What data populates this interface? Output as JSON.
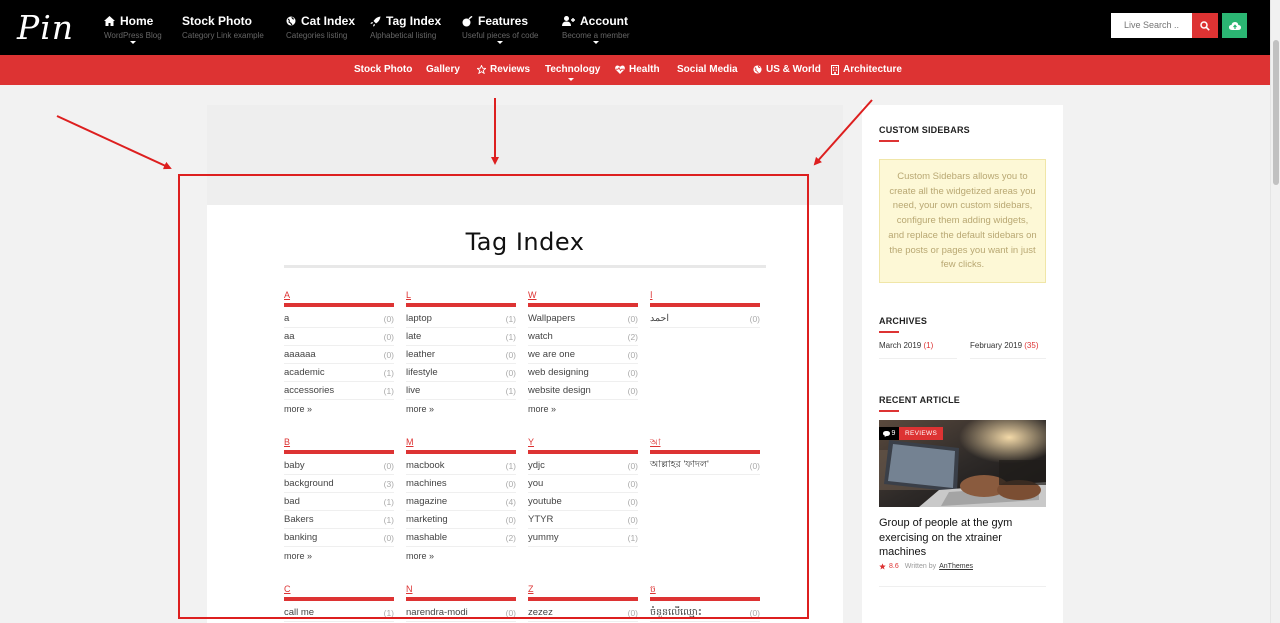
{
  "header": {
    "logo": "Pin",
    "nav": [
      {
        "label": "Home",
        "sub": "WordPress Blog",
        "icon": "home-icon",
        "has_caret": true
      },
      {
        "label": "Stock Photo",
        "sub": "Category Link example",
        "icon": "",
        "has_caret": false
      },
      {
        "label": "Cat Index",
        "sub": "Categories listing",
        "icon": "globe-icon",
        "has_caret": false
      },
      {
        "label": "Tag Index",
        "sub": "Alphabetical listing",
        "icon": "rocket-icon",
        "has_caret": false
      },
      {
        "label": "Features",
        "sub": "Useful pieces of code",
        "icon": "bomb-icon",
        "has_caret": true
      },
      {
        "label": "Account",
        "sub": "Become a member",
        "icon": "user-plus-icon",
        "has_caret": true
      }
    ],
    "search_placeholder": "Live Search ..",
    "accent": "#dd3333",
    "upload_color": "#2bb673"
  },
  "subnav": [
    {
      "label": "Stock Photo",
      "icon": ""
    },
    {
      "label": "Gallery",
      "icon": ""
    },
    {
      "label": "Reviews",
      "icon": "star-icon"
    },
    {
      "label": "Technology",
      "icon": ""
    },
    {
      "label": "Health",
      "icon": "heartbeat-icon"
    },
    {
      "label": "Social Media",
      "icon": ""
    },
    {
      "label": "US & World",
      "icon": "globe-icon"
    },
    {
      "label": "Architecture",
      "icon": "building-icon"
    }
  ],
  "main": {
    "title": "Tag Index",
    "more_label": "more »",
    "groups": [
      {
        "letter": "A",
        "tags": [
          [
            "a",
            "(0)"
          ],
          [
            "aa",
            "(0)"
          ],
          [
            "aaaaaa",
            "(0)"
          ],
          [
            "academic",
            "(1)"
          ],
          [
            "accessories",
            "(1)"
          ]
        ],
        "more": true
      },
      {
        "letter": "L",
        "tags": [
          [
            "laptop",
            "(1)"
          ],
          [
            "late",
            "(1)"
          ],
          [
            "leather",
            "(0)"
          ],
          [
            "lifestyle",
            "(0)"
          ],
          [
            "live",
            "(1)"
          ]
        ],
        "more": true
      },
      {
        "letter": "W",
        "tags": [
          [
            "Wallpapers",
            "(0)"
          ],
          [
            "watch",
            "(2)"
          ],
          [
            "we are one",
            "(0)"
          ],
          [
            "web designing",
            "(0)"
          ],
          [
            "website design",
            "(0)"
          ]
        ],
        "more": true
      },
      {
        "letter": "ا",
        "tags": [
          [
            "احمد",
            "(0)"
          ]
        ],
        "more": false
      },
      {
        "letter": "B",
        "tags": [
          [
            "baby",
            "(0)"
          ],
          [
            "background",
            "(3)"
          ],
          [
            "bad",
            "(1)"
          ],
          [
            "Bakers",
            "(1)"
          ],
          [
            "banking",
            "(0)"
          ]
        ],
        "more": true
      },
      {
        "letter": "M",
        "tags": [
          [
            "macbook",
            "(1)"
          ],
          [
            "machines",
            "(0)"
          ],
          [
            "magazine",
            "(4)"
          ],
          [
            "marketing",
            "(0)"
          ],
          [
            "mashable",
            "(2)"
          ]
        ],
        "more": true
      },
      {
        "letter": "Y",
        "tags": [
          [
            "ydjc",
            "(0)"
          ],
          [
            "you",
            "(0)"
          ],
          [
            "youtube",
            "(0)"
          ],
          [
            "YTYR",
            "(0)"
          ],
          [
            "yummy",
            "(1)"
          ]
        ],
        "more": false
      },
      {
        "letter": "আ",
        "tags": [
          [
            "আল্লাহর 'ফাদল'",
            "(0)"
          ]
        ],
        "more": false
      },
      {
        "letter": "C",
        "tags": [
          [
            "call me",
            "(1)"
          ]
        ],
        "more": false
      },
      {
        "letter": "N",
        "tags": [
          [
            "narendra-modi",
            "(0)"
          ]
        ],
        "more": false
      },
      {
        "letter": "Z",
        "tags": [
          [
            "zezez",
            "(0)"
          ]
        ],
        "more": false
      },
      {
        "letter": "ច",
        "tags": [
          [
            "ចំនួនលើឈ្មោះ",
            "(0)"
          ]
        ],
        "more": false
      }
    ]
  },
  "sidebar": {
    "custom_title": "CUSTOM SIDEBARS",
    "custom_text": "Custom Sidebars allows you to create all the widgetized areas you need, your own custom sidebars, configure them adding widgets, and replace the default sidebars on the posts or pages you want in just few clicks.",
    "archives_title": "ARCHIVES",
    "archives": [
      {
        "label": "March 2019",
        "count": "(1)"
      },
      {
        "label": "February 2019",
        "count": "(35)"
      }
    ],
    "recent_title": "RECENT ARTICLE",
    "recent": {
      "comments": "9",
      "category": "REVIEWS",
      "title": "Group of people at the gym exercising on the xtrainer machines",
      "rating": "8.6",
      "written_by": "Written by",
      "author": "AnThemes"
    }
  }
}
